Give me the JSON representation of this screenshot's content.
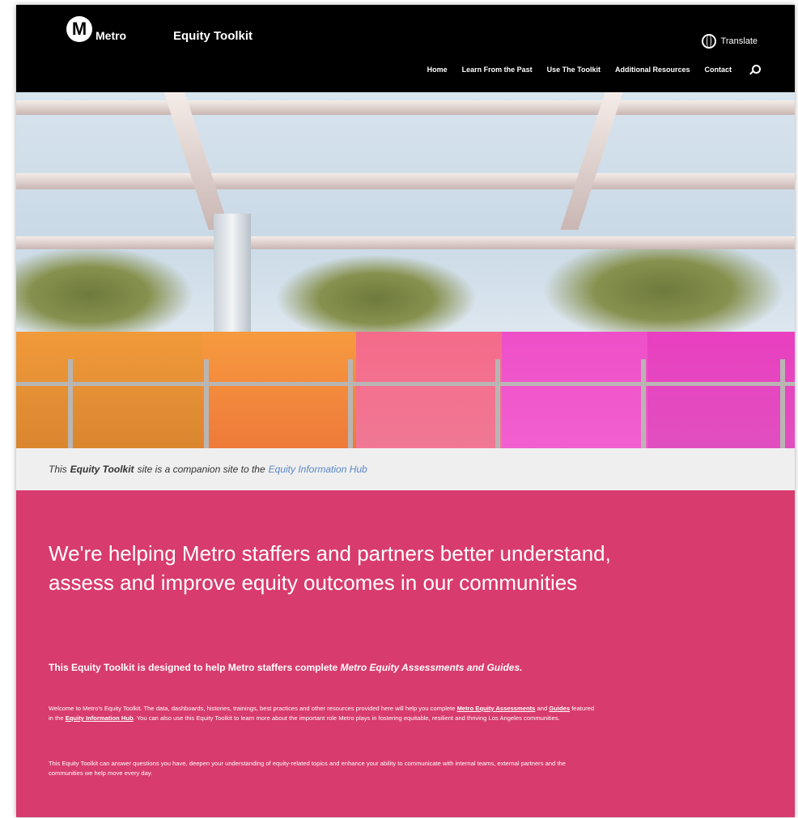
{
  "header": {
    "logo_text": "Metro",
    "logo_mark": "M",
    "site_title": "Equity Toolkit",
    "translate_label": "Translate",
    "nav": [
      {
        "label": "Home"
      },
      {
        "label": "Learn From the Past"
      },
      {
        "label": "Use The Toolkit"
      },
      {
        "label": "Additional Resources"
      },
      {
        "label": "Contact"
      }
    ],
    "icons": {
      "translate": "globe-icon",
      "search": "search-icon"
    }
  },
  "notice": {
    "pre": "This",
    "bold": "Equity Toolkit",
    "mid": "site is a companion site to the",
    "link": "Equity Information Hub"
  },
  "main": {
    "headline": "We're helping Metro staffers and partners better understand, assess and improve equity outcomes in our communities",
    "intro_pre": "This Equity Toolkit is designed to help Metro staffers complete",
    "intro_em": "Metro Equity Assessments and Guides.",
    "body1_a": "Welcome to Metro's Equity Toolkit. The data, dashboards, histories, trainings, best practices and other resources provided here will help you complete",
    "body1_link1": "Metro Equity Assessments",
    "body1_b": "and",
    "body1_link2": "Guides",
    "body1_c": "featured in the",
    "body1_link3": "Equity Information Hub",
    "body1_d": ". You can also use this Equity Toolkit to learn more about the important role Metro plays in fostering equitable, resilient and thriving Los Angeles communities.",
    "body2": "This Equity Toolkit can answer questions you have, deepen your understanding of equity-related topics and enhance your ability to communicate with internal teams, external partners and the communities we help move every day."
  },
  "colors": {
    "header_bg": "#000000",
    "accent_pink": "#d83b6e",
    "notice_bg": "#efefef",
    "link_blue": "#5b86c6"
  }
}
